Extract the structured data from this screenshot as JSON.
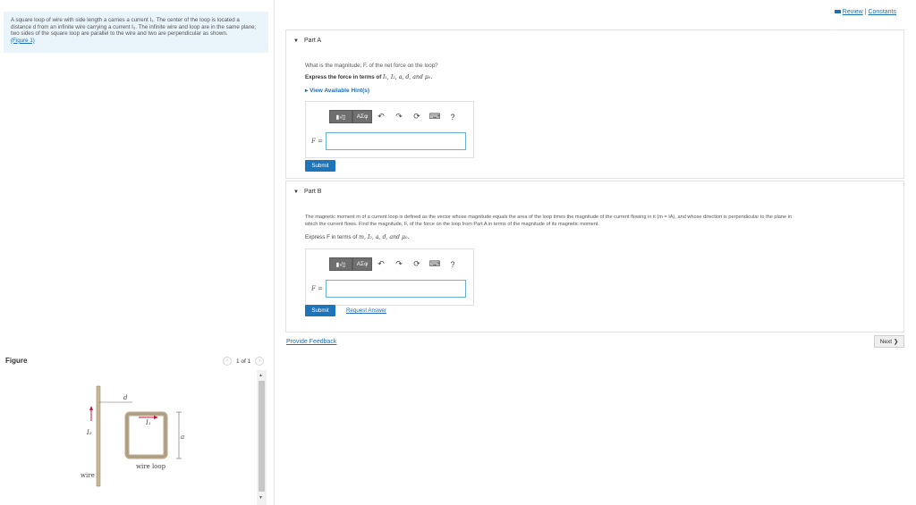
{
  "intro": {
    "text": "A square loop of wire with side length a carries a current I₁. The center of the loop is located a distance d from an infinite wire carrying a current I₂. The infinite wire and loop are in the same plane; two sides of the square loop are parallel to the wire and two are perpendicular as shown.",
    "figure_link": "(Figure 1)"
  },
  "top_links": {
    "review": "Review",
    "separator": "|",
    "constants": "Constants"
  },
  "part_a": {
    "title": "Part A",
    "question": "What is the magnitude, F, of the net force on the loop?",
    "instruction_prefix": "Express the force in terms of ",
    "instruction_vars": "I₁, I₂, a, d, and μ₀.",
    "hint": "View Available Hint(s)",
    "toolbar_label": "ΑΣφ",
    "answer_label": "F =",
    "submit": "Submit"
  },
  "part_b": {
    "title": "Part B",
    "question_line1": "The magnetic moment m of a current loop is defined as the vector whose magnitude equals the area of the loop times the magnitude of the current flowing in it (m = IA), and whose direction is perpendicular to the plane in",
    "question_line2": "which the current flows. Find the magnitude, F, of the force on the loop from Part A in terms of the magnitude of its magnetic moment.",
    "instruction_prefix": "Express F in terms of ",
    "instruction_vars": "m, I₂, a, d, and μ₀.",
    "toolbar_label": "ΑΣφ",
    "answer_label": "F =",
    "submit": "Submit",
    "request_answer": "Request Answer"
  },
  "feedback": "Provide Feedback",
  "next": "Next",
  "figure": {
    "title": "Figure",
    "pager": "1 of 1",
    "labels": {
      "d": "d",
      "I1": "I₁",
      "a": "a",
      "I2": "I₂",
      "wire": "wire",
      "loop": "wire loop"
    }
  }
}
